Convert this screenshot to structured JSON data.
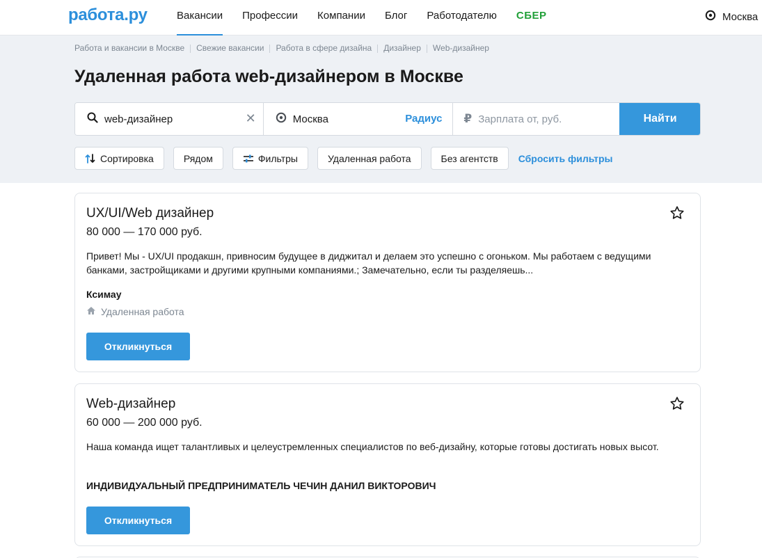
{
  "header": {
    "logo": "работа.ру",
    "nav": [
      "Вакансии",
      "Профессии",
      "Компании",
      "Блог",
      "Работодателю",
      "СБЕР"
    ],
    "city": "Москва"
  },
  "breadcrumbs": [
    "Работа и вакансии в Москве",
    "Свежие вакансии",
    "Работа в сфере дизайна",
    "Дизайнер",
    "Web-дизайнер"
  ],
  "page_title": "Удаленная работа web-дизайнером в Москве",
  "search": {
    "query_value": "web-дизайнер",
    "location_value": "Москва",
    "radius_label": "Радиус",
    "salary_placeholder": "Зарплата от, руб.",
    "submit_label": "Найти"
  },
  "filters": {
    "sort": "Сортировка",
    "nearby": "Рядом",
    "filters": "Фильтры",
    "remote": "Удаленная работа",
    "no_agencies": "Без агентств",
    "reset": "Сбросить фильтры"
  },
  "vacancies": [
    {
      "title": "UX/UI/Web дизайнер",
      "salary": "80 000 — 170 000 руб.",
      "description": "Привет! Мы - UX/UI продакшн, привносим будущее в диджитал и делаем это успешно с огоньком. Мы работаем с ведущими банками, застройщиками и другими крупными компаниями.; Замечательно, если ты разделяешь...",
      "company": "Ксимау",
      "work_format": "Удаленная работа",
      "apply_label": "Откликнуться"
    },
    {
      "title": "Web-дизайнер",
      "salary": "60 000 — 200 000 руб.",
      "description": "Наша команда ищет талантливых и целеустремленных специалистов по веб-дизайну, которые готовы достигать новых высот.",
      "company": "ИНДИВИДУАЛЬНЫЙ ПРЕДПРИНИМАТЕЛЬ ЧЕЧИН ДАНИЛ ВИКТОРОВИЧ",
      "apply_label": "Откликнуться"
    }
  ],
  "colors": {
    "brand": "#2c8fdb",
    "button": "#3597dc",
    "sber": "#21a038",
    "band": "#eef1f5"
  }
}
